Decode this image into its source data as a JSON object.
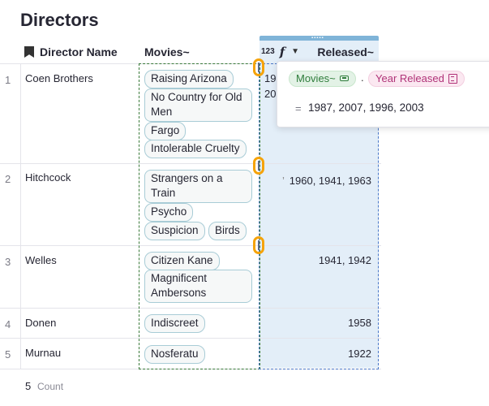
{
  "page": {
    "title": "Directors"
  },
  "columns": {
    "director": "Director Name",
    "movies": "Movies~",
    "released_type": "123",
    "released_formula": "f",
    "released": "Released~"
  },
  "rows": [
    {
      "num": "1",
      "director": "Coen Brothers",
      "movies": [
        "Raising Arizona",
        "No Country for Old Men",
        "Fargo",
        "Intolerable Cruelty"
      ],
      "released_clip_1": "19",
      "released_clip_2": "20"
    },
    {
      "num": "2",
      "director": "Hitchcock",
      "movies": [
        "Strangers on a Train",
        "Psycho",
        "Suspicion",
        "Birds"
      ],
      "released": "1960, 1941, 1963",
      "released_prefix": "’"
    },
    {
      "num": "3",
      "director": "Welles",
      "movies": [
        "Citizen Kane",
        "Magnificent Ambersons"
      ],
      "released": "1941, 1942"
    },
    {
      "num": "4",
      "director": "Donen",
      "movies": [
        "Indiscreet"
      ],
      "released": "1958"
    },
    {
      "num": "5",
      "director": "Murnau",
      "movies": [
        "Nosferatu"
      ],
      "released": "1922"
    }
  ],
  "formula_popup": {
    "ref_column": "Movies~",
    "dot": ".",
    "field": "Year Released",
    "equals": "=",
    "result": "1987, 2007, 1996, 2003"
  },
  "footer": {
    "count": "5",
    "label": "Count"
  },
  "colors": {
    "accent_blue": "#4a78c8",
    "highlight_orange": "#f5a30a",
    "dash_green": "#3a7a3a"
  }
}
